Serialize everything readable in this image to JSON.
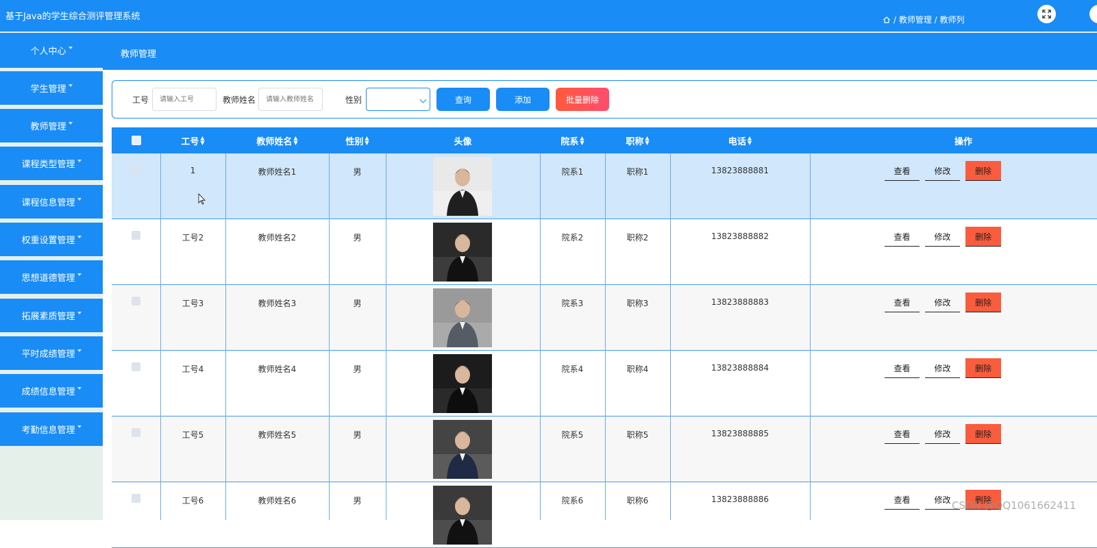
{
  "app": {
    "title": "基于Java的学生综合测评管理系统"
  },
  "sidebar": {
    "items": [
      {
        "label": "个人中心"
      },
      {
        "label": "学生管理"
      },
      {
        "label": "教师管理"
      },
      {
        "label": "课程类型管理"
      },
      {
        "label": "课程信息管理"
      },
      {
        "label": "权重设置管理"
      },
      {
        "label": "思想道德管理"
      },
      {
        "label": "拓展素质管理"
      },
      {
        "label": "平时成绩管理"
      },
      {
        "label": "成绩信息管理"
      },
      {
        "label": "考勤信息管理"
      }
    ]
  },
  "header": {
    "page_title": "教师管理",
    "breadcrumb": "/ 教师管理 / 教师列"
  },
  "search": {
    "id_label": "工号",
    "id_placeholder": "请输入工号",
    "name_label": "教师姓名",
    "name_placeholder": "请输入教师姓名",
    "gender_label": "性别",
    "gender_value": "",
    "query_label": "查询",
    "add_label": "添加",
    "batch_delete_label": "批量删除"
  },
  "table": {
    "headers": {
      "id": "工号",
      "name": "教师姓名",
      "gender": "性别",
      "avatar": "头像",
      "dept": "院系",
      "title": "职称",
      "phone": "电话",
      "ops": "操作"
    },
    "rows": [
      {
        "id": "1",
        "name": "教师姓名1",
        "gender": "男",
        "dept": "院系1",
        "title": "职称1",
        "phone": "13823888881",
        "view": "查看",
        "edit": "修改",
        "delete": "删除"
      },
      {
        "id": "工号2",
        "name": "教师姓名2",
        "gender": "男",
        "dept": "院系2",
        "title": "职称2",
        "phone": "13823888882",
        "view": "查看",
        "edit": "修改",
        "delete": "删除"
      },
      {
        "id": "工号3",
        "name": "教师姓名3",
        "gender": "男",
        "dept": "院系3",
        "title": "职称3",
        "phone": "13823888883",
        "view": "查看",
        "edit": "修改",
        "delete": "删除"
      },
      {
        "id": "工号4",
        "name": "教师姓名4",
        "gender": "男",
        "dept": "院系4",
        "title": "职称4",
        "phone": "13823888884",
        "view": "查看",
        "edit": "修改",
        "delete": "删除"
      },
      {
        "id": "工号5",
        "name": "教师姓名5",
        "gender": "男",
        "dept": "院系5",
        "title": "职称5",
        "phone": "13823888885",
        "view": "查看",
        "edit": "修改",
        "delete": "删除"
      },
      {
        "id": "工号6",
        "name": "教师姓名6",
        "gender": "男",
        "dept": "院系6",
        "title": "职称6",
        "phone": "13823888886",
        "view": "查看",
        "edit": "修改",
        "delete": "删除"
      }
    ]
  },
  "watermark": "CSDN @QQ1061662411",
  "colors": {
    "primary": "#198cf6",
    "danger": "#fa5c3e",
    "selected_row": "#d0e7fc",
    "sidebar_bg": "#e5f0ea"
  }
}
